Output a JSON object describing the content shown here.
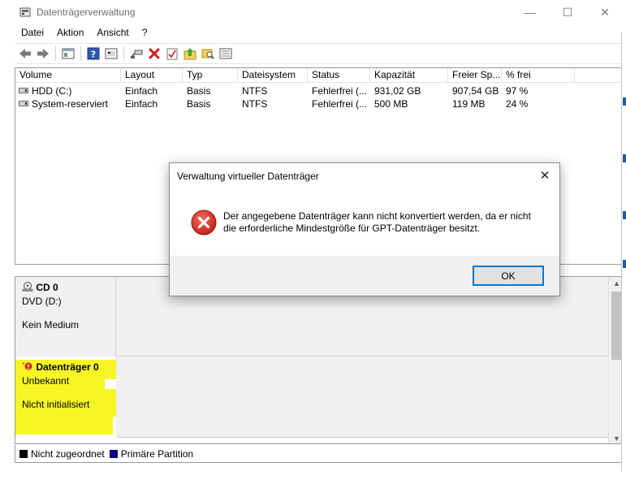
{
  "window": {
    "title": "Datenträgerverwaltung",
    "min_glyph": "—",
    "max_glyph": "☐",
    "close_glyph": "✕"
  },
  "menu": {
    "items": [
      "Datei",
      "Aktion",
      "Ansicht",
      "?"
    ]
  },
  "toolbar": {
    "icons": [
      "back-icon",
      "forward-icon",
      "properties-icon",
      "help-icon",
      "console-icon",
      "connect-icon",
      "delete-icon",
      "checklist-icon",
      "upload-icon",
      "search-folder-icon",
      "list-icon"
    ]
  },
  "volume_list": {
    "columns": [
      "Volume",
      "Layout",
      "Typ",
      "Dateisystem",
      "Status",
      "Kapazität",
      "Freier Sp...",
      "% frei"
    ],
    "rows": [
      [
        "HDD (C:)",
        "Einfach",
        "Basis",
        "NTFS",
        "Fehlerfrei (...",
        "931,02 GB",
        "907,54 GB",
        "97 %"
      ],
      [
        "System-reserviert",
        "Einfach",
        "Basis",
        "NTFS",
        "Fehlerfrei (...",
        "500 MB",
        "119 MB",
        "24 %"
      ]
    ]
  },
  "disks": {
    "cd0": {
      "title": "CD 0",
      "line1": "DVD (D:)",
      "line2": "Kein Medium"
    },
    "disk0": {
      "title": "Datenträger 0",
      "line1": "Unbekannt",
      "line2": "Nicht initialisiert"
    }
  },
  "legend": {
    "unallocated": "Nicht zugeordnet",
    "primary": "Primäre Partition",
    "unallocated_color": "#000000",
    "primary_color": "#000080"
  },
  "dialog": {
    "title": "Verwaltung virtueller Datenträger",
    "message_line1": "Der angegebene Datenträger kann nicht konvertiert werden, da er nicht",
    "message_line2": "die erforderliche Mindestgröße für GPT-Datenträger besitzt.",
    "ok_label": "OK",
    "close_glyph": "✕"
  },
  "colors": {
    "error_red": "#d9261c",
    "highlight_yellow": "#f4f400",
    "accent_blue": "#0078d7"
  }
}
